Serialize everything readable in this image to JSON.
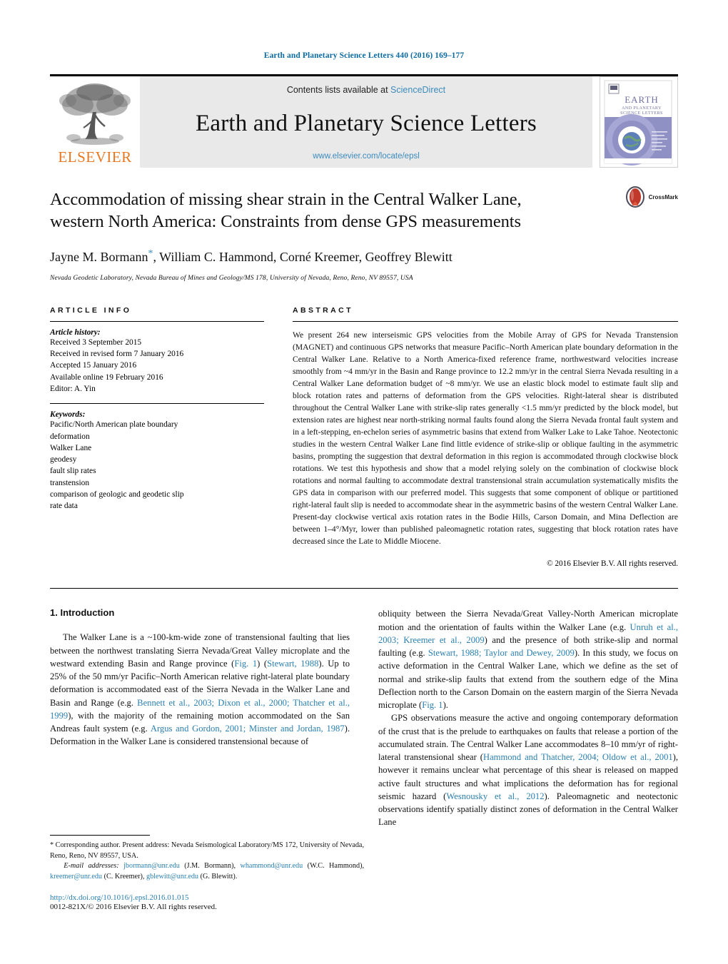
{
  "running_head": "Earth and Planetary Science Letters 440 (2016) 169–177",
  "masthead": {
    "contents_prefix": "Contents lists available at ",
    "sciencedirect": "ScienceDirect",
    "journal_title": "Earth and Planetary Science Letters",
    "journal_url": "www.elsevier.com/locate/epsl",
    "publisher_wordmark": "ELSEVIER",
    "publisher_logo_icon": "elsevier-tree-icon",
    "cover_icon": "journal-cover-thumbnail",
    "cover_title_line1": "EARTH",
    "cover_title_line2": "AND PLANETARY",
    "cover_title_line3": "SCIENCE LETTERS"
  },
  "title_block": {
    "title_line1": "Accommodation of missing shear strain in the Central Walker Lane,",
    "title_line2": "western North America: Constraints from dense GPS measurements",
    "authors": "Jayne M. Bormann",
    "authors_rest": ", William C. Hammond, Corné Kreemer, Geoffrey Blewitt",
    "corresponding_marker": "*",
    "affiliation": "Nevada Geodetic Laboratory, Nevada Bureau of Mines and Geology/MS 178, University of Nevada, Reno, Reno, NV 89557, USA",
    "crossmark_label": "CrossMark",
    "crossmark_icon": "crossmark-badge-icon"
  },
  "article_info": {
    "heading": "ARTICLE INFO",
    "history_label": "Article history:",
    "history": [
      "Received 3 September 2015",
      "Received in revised form 7 January 2016",
      "Accepted 15 January 2016",
      "Available online 19 February 2016",
      "Editor: A. Yin"
    ],
    "keywords_label": "Keywords:",
    "keywords": [
      "Pacific/North American plate boundary",
      "deformation",
      "Walker Lane",
      "geodesy",
      "fault slip rates",
      "transtension",
      "comparison of geologic and geodetic slip",
      "rate data"
    ]
  },
  "abstract": {
    "heading": "ABSTRACT",
    "text": "We present 264 new interseismic GPS velocities from the Mobile Array of GPS for Nevada Transtension (MAGNET) and continuous GPS networks that measure Pacific–North American plate boundary deformation in the Central Walker Lane. Relative to a North America-fixed reference frame, northwestward velocities increase smoothly from ~4 mm/yr in the Basin and Range province to 12.2 mm/yr in the central Sierra Nevada resulting in a Central Walker Lane deformation budget of ~8 mm/yr. We use an elastic block model to estimate fault slip and block rotation rates and patterns of deformation from the GPS velocities. Right-lateral shear is distributed throughout the Central Walker Lane with strike-slip rates generally <1.5 mm/yr predicted by the block model, but extension rates are highest near north-striking normal faults found along the Sierra Nevada frontal fault system and in a left-stepping, en-echelon series of asymmetric basins that extend from Walker Lake to Lake Tahoe. Neotectonic studies in the western Central Walker Lane find little evidence of strike-slip or oblique faulting in the asymmetric basins, prompting the suggestion that dextral deformation in this region is accommodated through clockwise block rotations. We test this hypothesis and show that a model relying solely on the combination of clockwise block rotations and normal faulting to accommodate dextral transtensional strain accumulation systematically misfits the GPS data in comparison with our preferred model. This suggests that some component of oblique or partitioned right-lateral fault slip is needed to accommodate shear in the asymmetric basins of the western Central Walker Lane. Present-day clockwise vertical axis rotation rates in the Bodie Hills, Carson Domain, and Mina Deflection are between 1–4°/Myr, lower than published paleomagnetic rotation rates, suggesting that block rotation rates have decreased since the Late to Middle Miocene.",
    "copyright": "© 2016 Elsevier B.V. All rights reserved."
  },
  "body": {
    "section_heading": "1. Introduction",
    "left_paragraphs": [
      {
        "parts": [
          {
            "t": "The Walker Lane is a ~100-km-wide zone of transtensional faulting that lies between the northwest translating Sierra Nevada/Great Valley microplate and the westward extending Basin and Range province (",
            "link": false
          },
          {
            "t": "Fig. 1",
            "link": true
          },
          {
            "t": ") (",
            "link": false
          },
          {
            "t": "Stewart, 1988",
            "link": true
          },
          {
            "t": "). Up to 25% of the 50 mm/yr Pacific–North American relative right-lateral plate boundary deformation is accommodated east of the Sierra Nevada in the Walker Lane and Basin and Range (e.g. ",
            "link": false
          },
          {
            "t": "Bennett et al., 2003; Dixon et al., 2000; Thatcher et al., 1999",
            "link": true
          },
          {
            "t": "), with the majority of the remaining motion accommodated on the San Andreas fault system (e.g. ",
            "link": false
          },
          {
            "t": "Argus and Gordon, 2001; Minster and Jordan, 1987",
            "link": true
          },
          {
            "t": "). Deformation in the Walker Lane is considered transtensional because of",
            "link": false
          }
        ]
      }
    ],
    "right_paragraphs": [
      {
        "indent": false,
        "parts": [
          {
            "t": "obliquity between the Sierra Nevada/Great Valley-North American microplate motion and the orientation of faults within the Walker Lane (e.g. ",
            "link": false
          },
          {
            "t": "Unruh et al., 2003; Kreemer et al., 2009",
            "link": true
          },
          {
            "t": ") and the presence of both strike-slip and normal faulting (e.g. ",
            "link": false
          },
          {
            "t": "Stewart, 1988; Taylor and Dewey, 2009",
            "link": true
          },
          {
            "t": "). In this study, we focus on active deformation in the Central Walker Lane, which we define as the set of normal and strike-slip faults that extend from the southern edge of the Mina Deflection north to the Carson Domain on the eastern margin of the Sierra Nevada microplate (",
            "link": false
          },
          {
            "t": "Fig. 1",
            "link": true
          },
          {
            "t": ").",
            "link": false
          }
        ]
      },
      {
        "indent": true,
        "parts": [
          {
            "t": "GPS observations measure the active and ongoing contemporary deformation of the crust that is the prelude to earthquakes on faults that release a portion of the accumulated strain. The Central Walker Lane accommodates 8–10 mm/yr of right-lateral transtensional shear (",
            "link": false
          },
          {
            "t": "Hammond and Thatcher, 2004; Oldow et al., 2001",
            "link": true
          },
          {
            "t": "), however it remains unclear what percentage of this shear is released on mapped active fault structures and what implications the deformation has for regional seismic hazard (",
            "link": false
          },
          {
            "t": "Wesnousky et al., 2012",
            "link": true
          },
          {
            "t": "). Paleomagnetic and neotectonic observations identify spatially distinct zones of deformation in the Central Walker Lane",
            "link": false
          }
        ]
      }
    ]
  },
  "footnote": {
    "corresponding": "* Corresponding author. Present address: Nevada Seismological Laboratory/MS 172, University of Nevada, Reno, Reno, NV 89557, USA.",
    "email_label": "E-mail addresses:",
    "emails": [
      {
        "addr": "jbormann@unr.edu",
        "name": "(J.M. Bormann)"
      },
      {
        "addr": "whammond@unr.edu",
        "name": "(W.C. Hammond)"
      },
      {
        "addr": "kreemer@unr.edu",
        "name": "(C. Kreemer)"
      },
      {
        "addr": "gblewitt@unr.edu",
        "name": "(G. Blewitt)"
      }
    ],
    "doi": "http://dx.doi.org/10.1016/j.epsl.2016.01.015",
    "issn": "0012-821X/© 2016 Elsevier B.V. All rights reserved."
  },
  "colors": {
    "link": "#2a7fb0",
    "running_head": "#0b6aa2",
    "elsevier_orange": "#E87722",
    "band_gray": "#e9e9e9"
  }
}
